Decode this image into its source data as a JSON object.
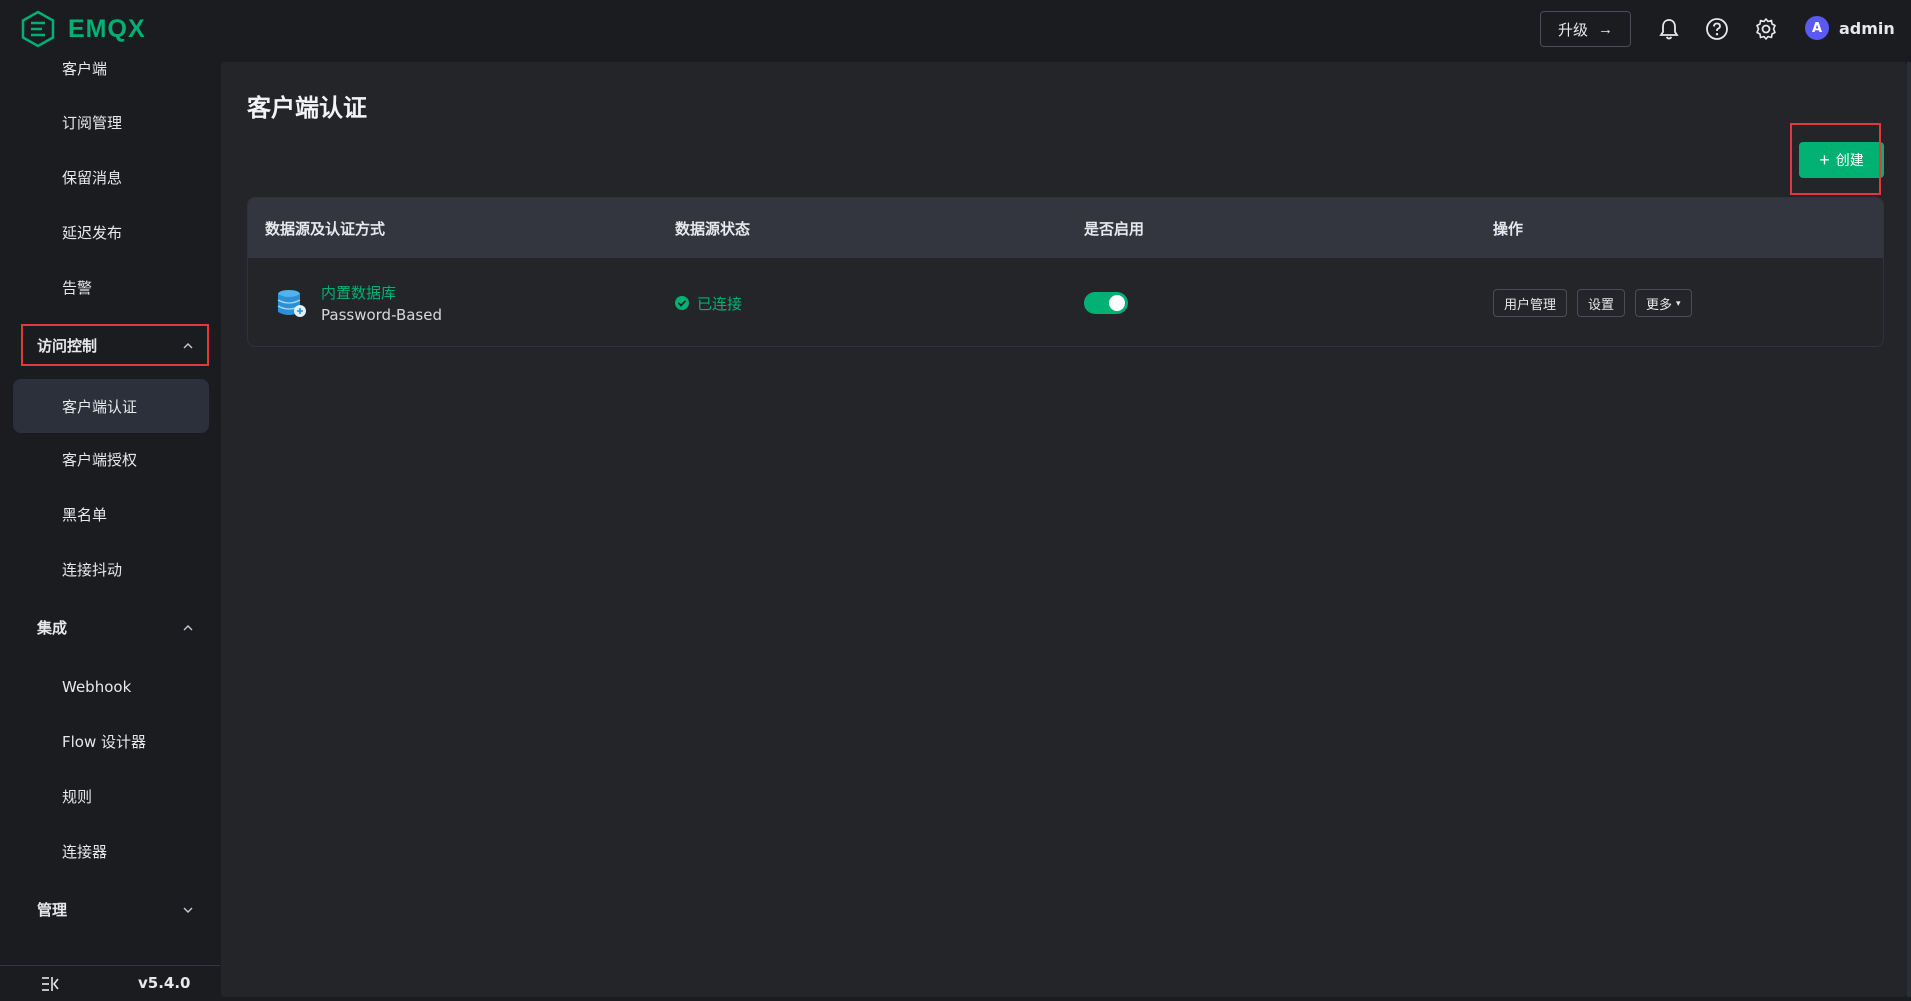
{
  "header": {
    "logo_text": "EMQX",
    "upgrade_label": "升级",
    "username": "admin",
    "avatar_letter": "A",
    "icons": [
      "bell-icon",
      "help-icon",
      "gear-icon"
    ]
  },
  "sidebar": {
    "items": [
      {
        "label": "客户端",
        "type": "item"
      },
      {
        "label": "订阅管理",
        "type": "item"
      },
      {
        "label": "保留消息",
        "type": "item"
      },
      {
        "label": "延迟发布",
        "type": "item"
      },
      {
        "label": "告警",
        "type": "item"
      },
      {
        "label": "访问控制",
        "type": "group",
        "expanded": true
      },
      {
        "label": "客户端认证",
        "type": "item",
        "active": true
      },
      {
        "label": "客户端授权",
        "type": "item"
      },
      {
        "label": "黑名单",
        "type": "item"
      },
      {
        "label": "连接抖动",
        "type": "item"
      },
      {
        "label": "集成",
        "type": "group",
        "expanded": true
      },
      {
        "label": "Webhook",
        "type": "item"
      },
      {
        "label": "Flow 设计器",
        "type": "item"
      },
      {
        "label": "规则",
        "type": "item"
      },
      {
        "label": "连接器",
        "type": "item"
      },
      {
        "label": "管理",
        "type": "group",
        "expanded": false
      }
    ],
    "version": "v5.4.0"
  },
  "main": {
    "title": "客户端认证",
    "create_label": "创建",
    "table": {
      "headers": [
        "数据源及认证方式",
        "数据源状态",
        "是否启用",
        "操作"
      ],
      "rows": [
        {
          "source": "内置数据库",
          "mechanism": "Password-Based",
          "status": "已连接",
          "enabled": true,
          "actions": [
            "用户管理",
            "设置",
            "更多"
          ]
        }
      ]
    }
  },
  "colors": {
    "accent": "#00b173",
    "highlight_box": "#e4393c",
    "background": "#1b1c20",
    "panel": "#232529"
  }
}
